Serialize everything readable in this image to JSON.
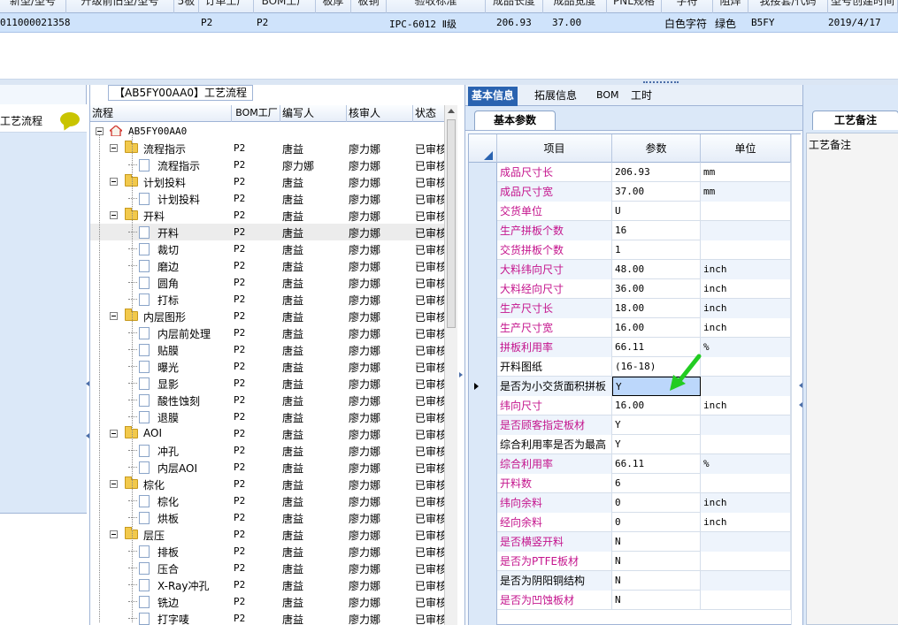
{
  "top_grid": {
    "headers": [
      "新型/型号",
      "升级前旧型/型号",
      "5板",
      "订单工厂",
      "BOM工厂",
      "板厚",
      "板铜",
      "验收标准",
      "成品长度",
      "成品宽度",
      "PNL规格",
      "字符",
      "阻焊",
      "我接套/代码",
      "型号创建时间"
    ],
    "row": {
      "code": "011000021358",
      "factory": "P2",
      "bom": "P2",
      "standard": "IPC-6012 Ⅱ级",
      "length": "206.93",
      "width": "37.00",
      "char": "白色字符",
      "mask": "绿色",
      "code2": "B5FY",
      "date": "2019/4/17"
    }
  },
  "left_strip": {
    "label": "工艺流程"
  },
  "tree_panel": {
    "title": "【AB5FY00AA0】工艺流程",
    "headers": {
      "flow": "流程",
      "bom": "BOM工厂",
      "writer": "编写人",
      "reviewer": "核审人",
      "status": "状态"
    },
    "root": "AB5FY00AA0",
    "rows": [
      {
        "name": "流程指示",
        "type": "folder",
        "bom": "P2",
        "writer": "唐益",
        "reviewer": "廖力娜",
        "status": "已审核"
      },
      {
        "name": "流程指示",
        "type": "doc",
        "bom": "P2",
        "writer": "廖力娜",
        "reviewer": "廖力娜",
        "status": "已审核"
      },
      {
        "name": "计划投料",
        "type": "folder",
        "bom": "P2",
        "writer": "唐益",
        "reviewer": "廖力娜",
        "status": "已审核"
      },
      {
        "name": "计划投料",
        "type": "doc",
        "bom": "P2",
        "writer": "唐益",
        "reviewer": "廖力娜",
        "status": "已审核"
      },
      {
        "name": "开料",
        "type": "folder",
        "bom": "P2",
        "writer": "唐益",
        "reviewer": "廖力娜",
        "status": "已审核"
      },
      {
        "name": "开料",
        "type": "doc",
        "bom": "P2",
        "writer": "唐益",
        "reviewer": "廖力娜",
        "status": "已审核",
        "selected": true
      },
      {
        "name": "裁切",
        "type": "doc",
        "bom": "P2",
        "writer": "唐益",
        "reviewer": "廖力娜",
        "status": "已审核"
      },
      {
        "name": "磨边",
        "type": "doc",
        "bom": "P2",
        "writer": "唐益",
        "reviewer": "廖力娜",
        "status": "已审核"
      },
      {
        "name": "圆角",
        "type": "doc",
        "bom": "P2",
        "writer": "唐益",
        "reviewer": "廖力娜",
        "status": "已审核"
      },
      {
        "name": "打标",
        "type": "doc",
        "bom": "P2",
        "writer": "唐益",
        "reviewer": "廖力娜",
        "status": "已审核"
      },
      {
        "name": "内层图形",
        "type": "folder",
        "bom": "P2",
        "writer": "唐益",
        "reviewer": "廖力娜",
        "status": "已审核"
      },
      {
        "name": "内层前处理",
        "type": "doc",
        "bom": "P2",
        "writer": "唐益",
        "reviewer": "廖力娜",
        "status": "已审核"
      },
      {
        "name": "贴膜",
        "type": "doc",
        "bom": "P2",
        "writer": "唐益",
        "reviewer": "廖力娜",
        "status": "已审核"
      },
      {
        "name": "曝光",
        "type": "doc",
        "bom": "P2",
        "writer": "唐益",
        "reviewer": "廖力娜",
        "status": "已审核"
      },
      {
        "name": "显影",
        "type": "doc",
        "bom": "P2",
        "writer": "唐益",
        "reviewer": "廖力娜",
        "status": "已审核"
      },
      {
        "name": "酸性蚀刻",
        "type": "doc",
        "bom": "P2",
        "writer": "唐益",
        "reviewer": "廖力娜",
        "status": "已审核"
      },
      {
        "name": "退膜",
        "type": "doc",
        "bom": "P2",
        "writer": "唐益",
        "reviewer": "廖力娜",
        "status": "已审核"
      },
      {
        "name": "AOI",
        "type": "folder",
        "bom": "P2",
        "writer": "唐益",
        "reviewer": "廖力娜",
        "status": "已审核"
      },
      {
        "name": "冲孔",
        "type": "doc",
        "bom": "P2",
        "writer": "唐益",
        "reviewer": "廖力娜",
        "status": "已审核"
      },
      {
        "name": "内层AOI",
        "type": "doc",
        "bom": "P2",
        "writer": "唐益",
        "reviewer": "廖力娜",
        "status": "已审核"
      },
      {
        "name": "棕化",
        "type": "folder",
        "bom": "P2",
        "writer": "唐益",
        "reviewer": "廖力娜",
        "status": "已审核"
      },
      {
        "name": "棕化",
        "type": "doc",
        "bom": "P2",
        "writer": "唐益",
        "reviewer": "廖力娜",
        "status": "已审核"
      },
      {
        "name": "烘板",
        "type": "doc",
        "bom": "P2",
        "writer": "唐益",
        "reviewer": "廖力娜",
        "status": "已审核"
      },
      {
        "name": "层压",
        "type": "folder",
        "bom": "P2",
        "writer": "唐益",
        "reviewer": "廖力娜",
        "status": "已审核"
      },
      {
        "name": "排板",
        "type": "doc",
        "bom": "P2",
        "writer": "唐益",
        "reviewer": "廖力娜",
        "status": "已审核"
      },
      {
        "name": "压合",
        "type": "doc",
        "bom": "P2",
        "writer": "唐益",
        "reviewer": "廖力娜",
        "status": "已审核"
      },
      {
        "name": "X-Ray冲孔",
        "type": "doc",
        "bom": "P2",
        "writer": "唐益",
        "reviewer": "廖力娜",
        "status": "已审核"
      },
      {
        "name": "铣边",
        "type": "doc",
        "bom": "P2",
        "writer": "唐益",
        "reviewer": "廖力娜",
        "status": "已审核"
      },
      {
        "name": "打字唛",
        "type": "doc",
        "bom": "P2",
        "writer": "唐益",
        "reviewer": "廖力娜",
        "status": "已审核"
      }
    ]
  },
  "right_panel": {
    "tabs": [
      "基本信息",
      "拓展信息",
      "BOM",
      "工时"
    ],
    "active_tab": 0,
    "sub_tab": "基本参数",
    "headers": {
      "item": "项目",
      "param": "参数",
      "unit": "单位"
    },
    "rows": [
      {
        "item": "成品尺寸长",
        "val": "206.93",
        "unit": "mm",
        "magenta": true
      },
      {
        "item": "成品尺寸宽",
        "val": "37.00",
        "unit": "mm",
        "magenta": true
      },
      {
        "item": "交货单位",
        "val": "U",
        "unit": "",
        "magenta": true
      },
      {
        "item": "生产拼板个数",
        "val": "16",
        "unit": "",
        "magenta": true
      },
      {
        "item": "交货拼板个数",
        "val": "1",
        "unit": "",
        "magenta": true
      },
      {
        "item": "大料纬向尺寸",
        "val": "48.00",
        "unit": "inch",
        "magenta": true
      },
      {
        "item": "大料经向尺寸",
        "val": "36.00",
        "unit": "inch",
        "magenta": true
      },
      {
        "item": "生产尺寸长",
        "val": "18.00",
        "unit": "inch",
        "magenta": true
      },
      {
        "item": "生产尺寸宽",
        "val": "16.00",
        "unit": "inch",
        "magenta": true
      },
      {
        "item": "拼板利用率",
        "val": "66.11",
        "unit": "%",
        "magenta": true
      },
      {
        "item": "开料图纸",
        "val": "(16-18)",
        "unit": "",
        "magenta": false
      },
      {
        "item": "是否为小交货面积拼板",
        "val": "Y",
        "unit": "",
        "magenta": false,
        "selected": true
      },
      {
        "item": "纬向尺寸",
        "val": "16.00",
        "unit": "inch",
        "magenta": true
      },
      {
        "item": "是否顾客指定板材",
        "val": "Y",
        "unit": "",
        "magenta": true
      },
      {
        "item": "综合利用率是否为最高",
        "val": "Y",
        "unit": "",
        "magenta": false
      },
      {
        "item": "综合利用率",
        "val": "66.11",
        "unit": "%",
        "magenta": true
      },
      {
        "item": "开料数",
        "val": "6",
        "unit": "",
        "magenta": true
      },
      {
        "item": "纬向余料",
        "val": "0",
        "unit": "inch",
        "magenta": true
      },
      {
        "item": "经向余料",
        "val": "0",
        "unit": "inch",
        "magenta": true
      },
      {
        "item": "是否横竖开料",
        "val": "N",
        "unit": "",
        "magenta": true
      },
      {
        "item": "是否为PTFE板材",
        "val": "N",
        "unit": "",
        "magenta": true
      },
      {
        "item": "是否为阴阳铜结构",
        "val": "N",
        "unit": "",
        "magenta": false
      },
      {
        "item": "是否为凹蚀板材",
        "val": "N",
        "unit": "",
        "magenta": true
      }
    ]
  },
  "far_right": {
    "sub_tab": "工艺备注",
    "label": "工艺备注"
  },
  "colors": {
    "accent": "#2a63b0",
    "magenta_label": "#c4148d",
    "selected_row": "#cfe3fb",
    "arrow": "#22cc22"
  }
}
